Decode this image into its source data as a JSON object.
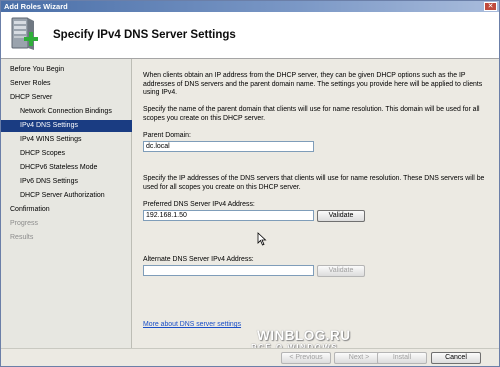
{
  "window": {
    "title": "Add Roles Wizard"
  },
  "header": {
    "heading": "Specify IPv4 DNS Server Settings",
    "icon": "server-role-add-icon"
  },
  "nav": {
    "items": [
      {
        "label": "Before You Begin",
        "level": 0,
        "state": "normal"
      },
      {
        "label": "Server Roles",
        "level": 0,
        "state": "normal"
      },
      {
        "label": "DHCP Server",
        "level": 0,
        "state": "normal"
      },
      {
        "label": "Network Connection Bindings",
        "level": 1,
        "state": "normal"
      },
      {
        "label": "IPv4 DNS Settings",
        "level": 1,
        "state": "active"
      },
      {
        "label": "IPv4 WINS Settings",
        "level": 1,
        "state": "normal"
      },
      {
        "label": "DHCP Scopes",
        "level": 1,
        "state": "normal"
      },
      {
        "label": "DHCPv6 Stateless Mode",
        "level": 1,
        "state": "normal"
      },
      {
        "label": "IPv6 DNS Settings",
        "level": 1,
        "state": "normal"
      },
      {
        "label": "DHCP Server Authorization",
        "level": 1,
        "state": "normal"
      },
      {
        "label": "Confirmation",
        "level": 0,
        "state": "normal"
      },
      {
        "label": "Progress",
        "level": 0,
        "state": "dim"
      },
      {
        "label": "Results",
        "level": 0,
        "state": "dim"
      }
    ]
  },
  "content": {
    "intro_line1": "When clients obtain an IP address from the DHCP server, they can be given DHCP options such as the IP",
    "intro_line2": "addresses of DNS servers and the parent domain name. The settings you provide here will be applied to clients",
    "intro_line3": "using IPv4.",
    "domain_desc_line1": "Specify the name of the parent domain that clients will use for name resolution. This domain will be used for all",
    "domain_desc_line2": "scopes you create on this DHCP server.",
    "parent_domain_label": "Parent Domain:",
    "parent_domain_value": "dc.local",
    "dns_desc_line1": "Specify the IP addresses of the DNS servers that clients will use for name resolution. These DNS servers will be",
    "dns_desc_line2": "used for all scopes you create on this DHCP server.",
    "preferred_label": "Preferred DNS Server IPv4 Address:",
    "preferred_value": "192.168.1.50",
    "validate_label": "Validate",
    "alternate_label": "Alternate DNS Server IPv4 Address:",
    "alternate_value": "",
    "validate2_label": "Validate",
    "more_link": "More about DNS server settings"
  },
  "footer": {
    "previous_label": "< Previous",
    "next_label": "Next >",
    "install_label": "Install",
    "cancel_label": "Cancel"
  },
  "watermark": {
    "line1": "WINBLOG.RU",
    "line2": "ВСЁ О WINDOWS"
  },
  "colors": {
    "active_nav": "#1a3c82",
    "link": "#1a4fc7",
    "titlebar": "#4a6fa8"
  }
}
